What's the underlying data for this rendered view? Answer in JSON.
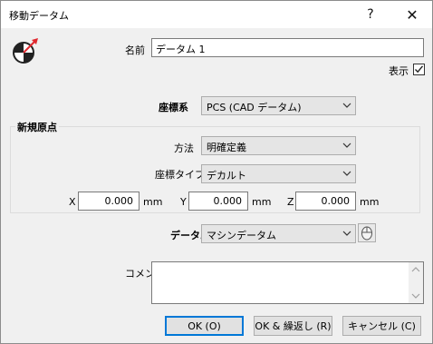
{
  "window": {
    "title": "移動データム"
  },
  "titlebar": {
    "help": "?",
    "close": "✕"
  },
  "name": {
    "label": "名前",
    "value": "データム 1"
  },
  "show": {
    "label": "表示",
    "checked": true
  },
  "coord": {
    "label": "座標系",
    "value": "PCS (CAD データム)"
  },
  "new_origin": {
    "title": "新規原点",
    "method_label": "方法",
    "method_value": "明確定義",
    "coord_type_label": "座標タイプ",
    "coord_type_value": "デカルト",
    "x_label": "X",
    "x_value": "0.000",
    "x_unit": "mm",
    "y_label": "Y",
    "y_value": "0.000",
    "y_unit": "mm",
    "z_label": "Z",
    "z_value": "0.000",
    "z_unit": "mm"
  },
  "datum": {
    "label": "データム",
    "value": "マシンデータム"
  },
  "comment": {
    "label": "コメント",
    "value": ""
  },
  "buttons": {
    "ok": "OK (O)",
    "ok_repeat": "OK & 繰返し (R)",
    "cancel": "キャンセル (C)"
  },
  "colors": {
    "accent": "#0078d7",
    "icon_red": "#e0282e"
  },
  "icons": {
    "datum_move": "datum-move-icon",
    "pick": "mouse-icon"
  }
}
